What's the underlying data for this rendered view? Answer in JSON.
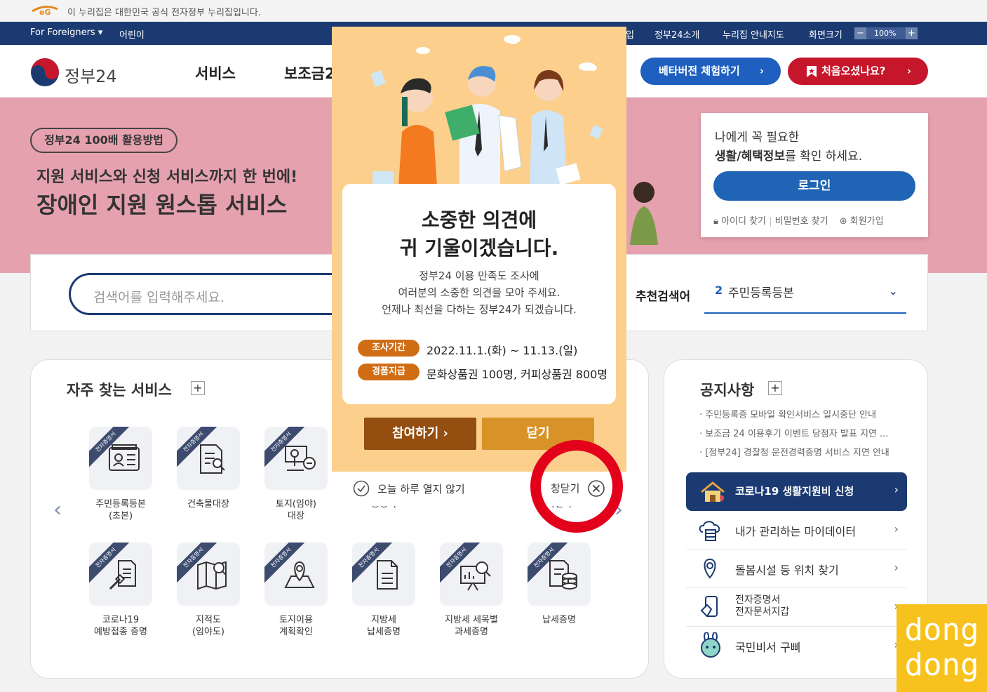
{
  "gov_notice": "이 누리집은 대한민국 공식 전자정부 누리집입니다.",
  "util": {
    "foreigners": "For Foreigners ▾",
    "kids": "어린이",
    "right_links": [
      "입",
      "정부24소개",
      "누리집 안내지도",
      "화면크기"
    ],
    "zoom_minus": "−",
    "zoom_value": "100%",
    "zoom_plus": "+"
  },
  "header": {
    "brand": "정부24",
    "menu": [
      "서비스",
      "보조금2"
    ],
    "beta_button": "베타버전 체험하기",
    "first_visit_button": "처음오셨나요?"
  },
  "hero": {
    "tag": "정부24 100배 활용방법",
    "line1": "지원 서비스와 신청 서비스까지 한 번에!",
    "line2": "장애인 지원 원스톱 서비스"
  },
  "login": {
    "line1": "나에게 꼭 필요한",
    "line2_bold": "생활/혜택정보",
    "line2_rest": "를 확인 하세요.",
    "button": "로그인",
    "find_id": "아이디 찾기",
    "find_pw": "비밀번호 찾기",
    "join": "회원가입"
  },
  "search": {
    "placeholder": "검색어를 입력해주세요.",
    "rec_label": "추천검색어",
    "rec_num": "2",
    "rec_term": "주민등록등본"
  },
  "frequent": {
    "title": "자주 찾는 서비스",
    "plus": "+",
    "ribbon": "전자증명서",
    "row1": [
      {
        "label": "주민등록등본\n(초본)"
      },
      {
        "label": "건축물대장"
      },
      {
        "label": "토지(임야)\n대장"
      },
      {
        "label": "증명서"
      },
      {
        "label": ""
      },
      {
        "label": "확인서"
      }
    ],
    "row2": [
      {
        "label": "코로나19\n예방접종 증명"
      },
      {
        "label": "지적도\n(임야도)"
      },
      {
        "label": "토지이용\n계획확인"
      },
      {
        "label": "지방세\n납세증명"
      },
      {
        "label": "지방세 세목별\n과세증명"
      },
      {
        "label": "납세증명"
      }
    ]
  },
  "notices": {
    "title": "공지사항",
    "plus": "+",
    "items": [
      "· 주민등록증 모바일 확인서비스 일시중단 안내",
      "· 보조금 24 이용후기 이벤트 당첨자 발표 지연 ...",
      "· [정부24] 경찰청 운전경력증명 서비스 지연 안내"
    ],
    "covid": "코로나19 생활지원비 신청",
    "links": [
      "내가 관리하는 마이데이터",
      "돌봄시설 등 위치 찾기",
      "전자증명서\n전자문서지갑",
      "국민비서 구삐"
    ]
  },
  "modal": {
    "title1": "소중한 의견에",
    "title2": "귀 기울이겠습니다.",
    "desc1": "정부24 이용 만족도 조사에",
    "desc2": "여러분의 소중한 의견을 모아 주세요.",
    "desc3": "언제나 최선을 다하는 정부24가 되겠습니다.",
    "period_badge": "조사기간",
    "period_value": "2022.11.1.(화) ~ 11.13.(일)",
    "prize_badge": "경품지급",
    "prize_value": "문화상품권 100명, 커피상품권 800명",
    "join_button": "참여하기 ›",
    "close_button": "닫기",
    "no_today": "오늘 하루 열지 않기",
    "window_close": "창닫기"
  },
  "watermark": [
    "dong",
    "dong"
  ]
}
